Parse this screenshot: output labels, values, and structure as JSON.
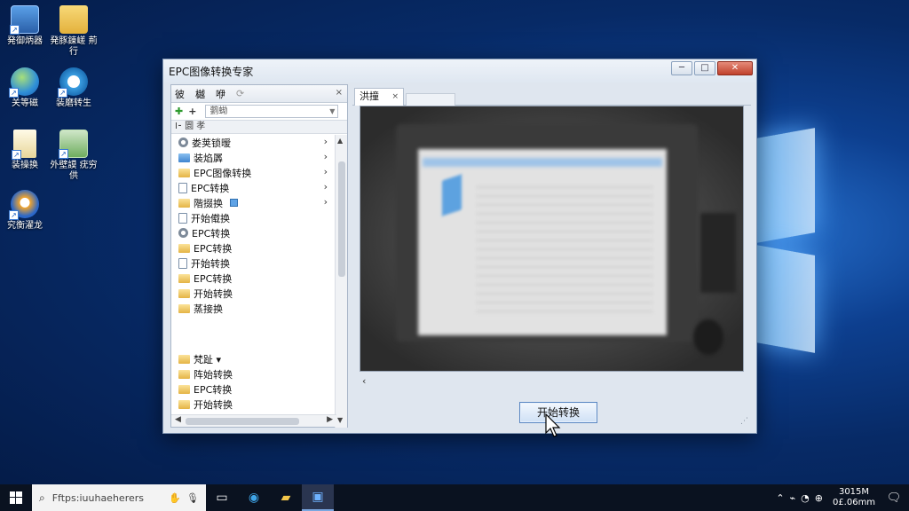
{
  "desktop": {
    "icons": [
      {
        "label": "発御炳器",
        "icon": "computer-icon"
      },
      {
        "label": "発豚錬嵯 荊行",
        "icon": "folder-icon"
      },
      {
        "label": "关等磁",
        "icon": "globe-icon"
      },
      {
        "label": "装磨转生",
        "icon": "internet-explorer-icon"
      },
      {
        "label": "装操换",
        "icon": "document-icon"
      },
      {
        "label": "外壁謨 疣穷供",
        "icon": "network-icon"
      },
      {
        "label": "究衡濯龙",
        "icon": "edge-icon"
      }
    ]
  },
  "window": {
    "title": "EPC图像转换专家",
    "controls": {
      "minimize": "─",
      "maximize": "□",
      "close": "✕"
    }
  },
  "left_panel": {
    "tabs": [
      "彼",
      "樾",
      "咿"
    ],
    "close": "×",
    "combo_value": "藰蜐",
    "header": "I⁃ 圜 孝",
    "items": [
      {
        "label": "娄荚锁暧",
        "icon": "gear-icon",
        "has_chevron": true
      },
      {
        "label": "装焰羼",
        "icon": "folderblue-icon",
        "has_chevron": true
      },
      {
        "label": "EPC图像转换",
        "icon": "folder-icon",
        "has_chevron": true
      },
      {
        "label": "EPC转换",
        "icon": "doc-icon",
        "has_chevron": true
      },
      {
        "label": "階掇换",
        "icon": "folder-icon",
        "has_chevron": true,
        "badge": true
      },
      {
        "label": "开始傤换",
        "icon": "doc-icon",
        "has_chevron": false
      },
      {
        "label": "EPC转换",
        "icon": "gear-icon",
        "has_chevron": false
      },
      {
        "label": "EPC转换",
        "icon": "folder-icon",
        "has_chevron": false
      },
      {
        "label": "开始转换",
        "icon": "doc-icon",
        "has_chevron": false
      },
      {
        "label": "EPC转换",
        "icon": "folder-icon",
        "has_chevron": false
      },
      {
        "label": "开始转换",
        "icon": "folder-icon",
        "has_chevron": false
      },
      {
        "label": "蒸接换",
        "icon": "folder-icon",
        "has_chevron": false
      }
    ],
    "items_lower": [
      {
        "label": "梵趾 ▾",
        "icon": "folder-icon"
      },
      {
        "label": "阵始转换",
        "icon": "folder-icon"
      },
      {
        "label": "EPC转换",
        "icon": "folder-icon"
      },
      {
        "label": "开始转换",
        "icon": "folder-icon"
      }
    ]
  },
  "right_panel": {
    "tab_label": "洪撞",
    "tab_close": "×",
    "nav_prev": "‹",
    "start_button": "开始转换"
  },
  "taskbar": {
    "search_placeholder": "Fftps:iuuhaeherers",
    "clock_time": "3015M",
    "clock_date": "0£.06mm"
  },
  "colors": {
    "desktop_bg": "#0d3f8f",
    "window_bg": "#dfe6ef",
    "close_button": "#c0412c",
    "accent_button": "#cfe0f5"
  }
}
